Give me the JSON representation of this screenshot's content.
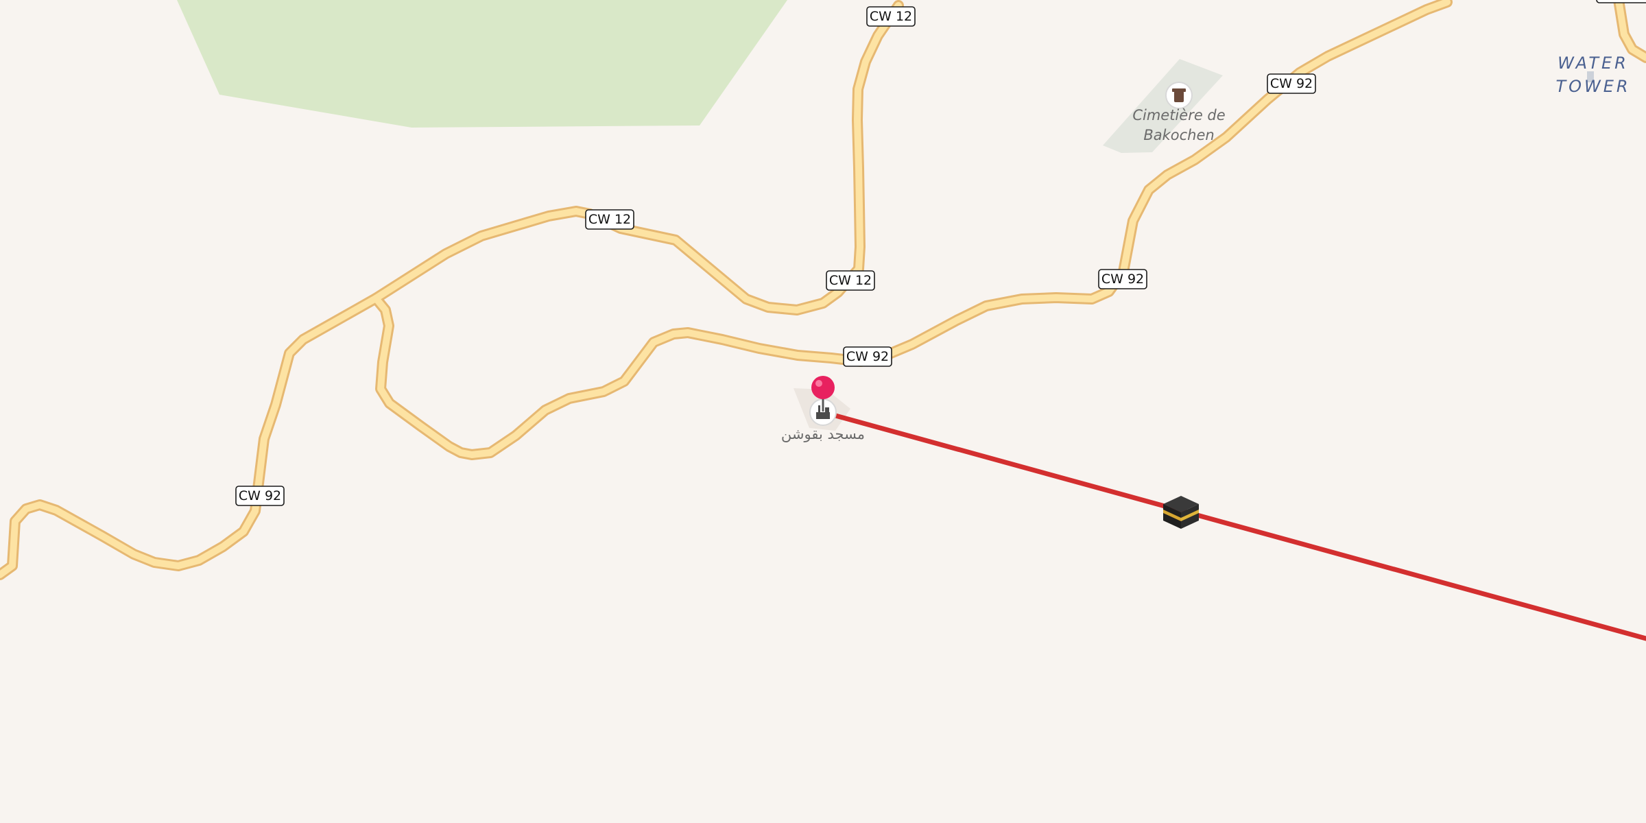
{
  "map": {
    "colors": {
      "background": "#f8f4f0",
      "wood": "#d9e8c8",
      "cemetery": "#e3e6df",
      "road_fill": "#fde3a3",
      "road_casing": "#e6b872",
      "qibla_line": "#d32f2f",
      "pin": "#e8215f"
    },
    "road_labels": [
      {
        "text": "CW 12"
      },
      {
        "text": "CW 12"
      },
      {
        "text": "CW 12"
      },
      {
        "text": "CW 92"
      },
      {
        "text": "CW 92"
      },
      {
        "text": "CW 92"
      },
      {
        "text": "CW 92"
      }
    ],
    "poi": {
      "cemetery": {
        "line1": "Cimetière de",
        "line2": "Bakochen",
        "icon": "cemetery-icon"
      },
      "water_tower": {
        "line1": "WATER",
        "line2": "TOWER"
      },
      "mosque": {
        "label": "مسجد بقوشن",
        "icon": "mosque-icon"
      }
    },
    "markers": {
      "location_pin": "location-pin-icon",
      "kaaba": "kaaba-icon"
    }
  }
}
